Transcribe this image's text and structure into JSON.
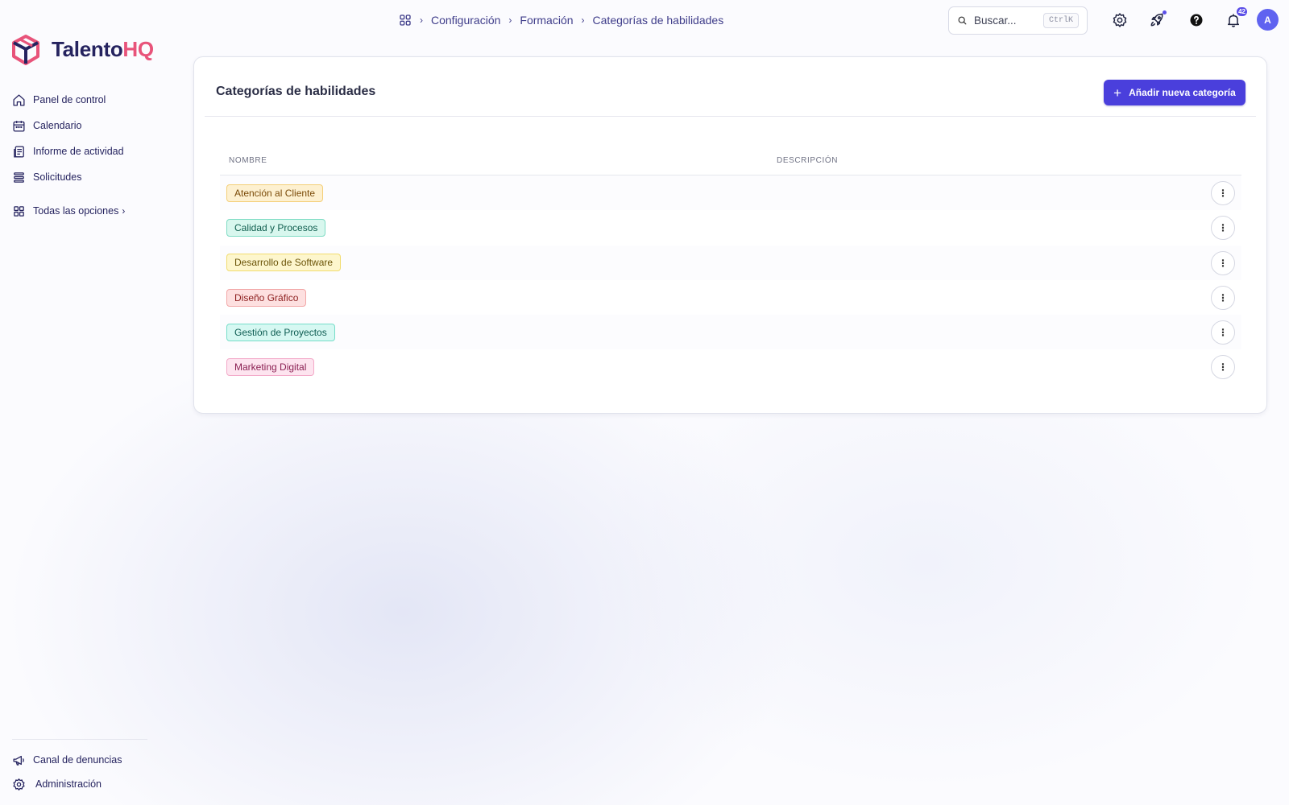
{
  "app": {
    "logo_part1": "Talento",
    "logo_part2": "HQ",
    "brand_colors": {
      "navy": "#25235f",
      "pink": "#e8537a",
      "accent": "#4a3fdc"
    }
  },
  "sidebar": {
    "items": [
      {
        "label": "Panel de control",
        "icon": "home-icon"
      },
      {
        "label": "Calendario",
        "icon": "calendar-icon"
      },
      {
        "label": "Informe de actividad",
        "icon": "report-icon"
      },
      {
        "label": "Solicitudes",
        "icon": "list-icon"
      }
    ],
    "all_options": {
      "label": "Todas las opciones",
      "icon": "grid-icon",
      "chevron": "›"
    },
    "bottom_items": [
      {
        "label": "Canal de denuncias",
        "icon": "megaphone-icon"
      },
      {
        "label": "Administración",
        "icon": "gear-icon"
      }
    ]
  },
  "breadcrumb": {
    "home_icon": "apps-icon",
    "separator": "›",
    "items": [
      "Configuración",
      "Formación",
      "Categorías de habilidades"
    ]
  },
  "search": {
    "placeholder": "Buscar...",
    "shortcut": "CtrlK"
  },
  "topbar": {
    "notifications_count": "42",
    "avatar_initial": "A",
    "icons": [
      "settings-icon",
      "rocket-icon",
      "help-icon",
      "bell-icon"
    ]
  },
  "main": {
    "title": "Categorías de habilidades",
    "add_button": {
      "icon": "+",
      "label": "Añadir nueva categoría"
    },
    "table": {
      "columns": [
        "NOMBRE",
        "DESCRIPCIÓN"
      ],
      "rows": [
        {
          "name": "Atención al Cliente",
          "description": "",
          "tag_bg": "#fdf0d0",
          "tag_border": "#f4cf78",
          "tag_text": "#7a4a08"
        },
        {
          "name": "Calidad y Procesos",
          "description": "",
          "tag_bg": "#d8f7ee",
          "tag_border": "#7fdcc4",
          "tag_text": "#0f5e4e"
        },
        {
          "name": "Desarrollo de Software",
          "description": "",
          "tag_bg": "#fdf6cd",
          "tag_border": "#f1dc6e",
          "tag_text": "#6b5408"
        },
        {
          "name": "Diseño Gráfico",
          "description": "",
          "tag_bg": "#fde0e0",
          "tag_border": "#f2a7a7",
          "tag_text": "#8c1d1d"
        },
        {
          "name": "Gestión de Proyectos",
          "description": "",
          "tag_bg": "#d6f8f2",
          "tag_border": "#76ddc9",
          "tag_text": "#0d5c52"
        },
        {
          "name": "Marketing Digital",
          "description": "",
          "tag_bg": "#fde4ef",
          "tag_border": "#f3a9c8",
          "tag_text": "#8a1f52"
        }
      ],
      "row_menu_icon": "⋮"
    }
  }
}
